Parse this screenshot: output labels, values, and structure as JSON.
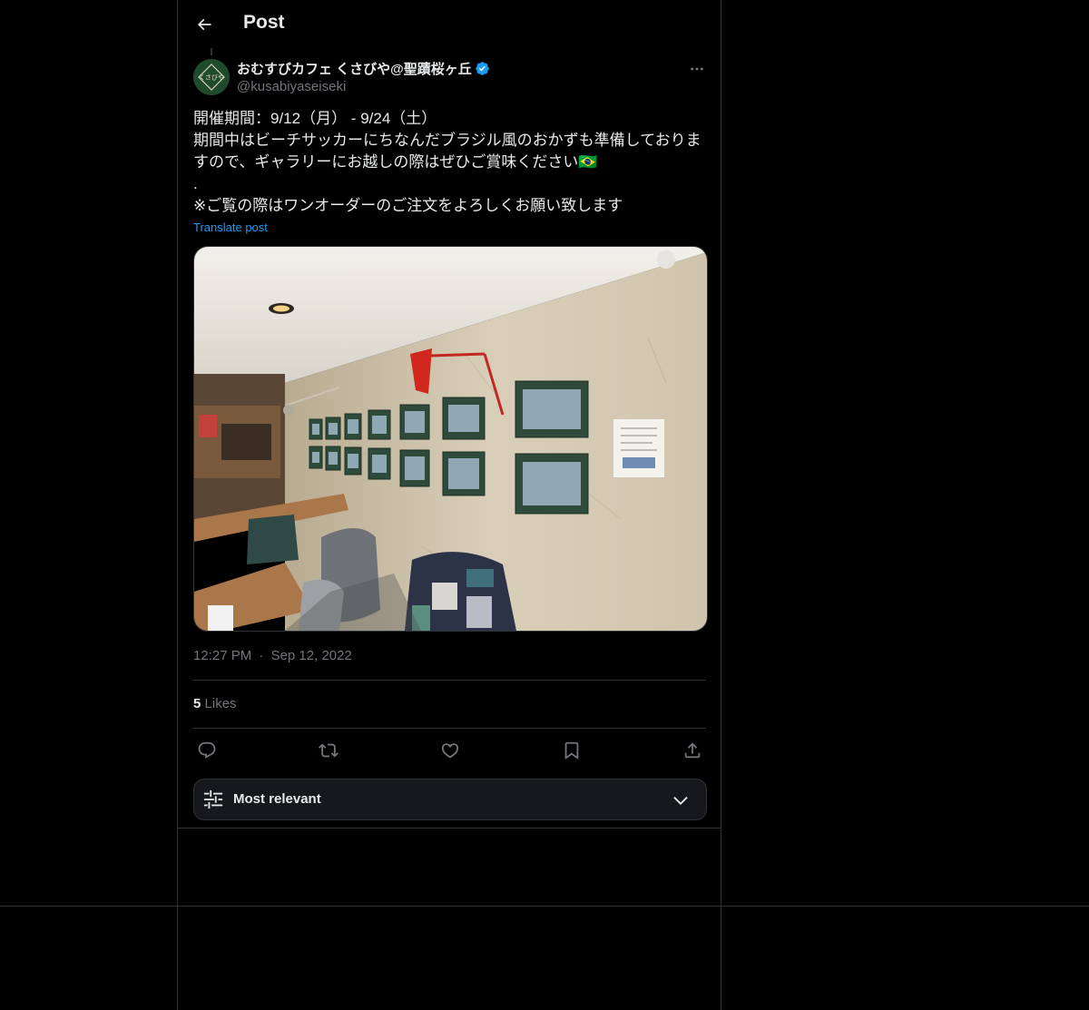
{
  "header": {
    "title": "Post"
  },
  "author": {
    "name": "おむすびカフェ くさびや@聖蹟桜ヶ丘",
    "handle": "@kusabiyaseiseki",
    "avatar_text": "くさびや"
  },
  "post": {
    "lines": [
      "開催期間：9/12（月） - 9/24（土）",
      "期間中はビーチサッカーにちなんだブラジル風のおかずも準備しておりますので、ギャラリーにお越しの際はぜひご賞味ください🇧🇷",
      ".",
      "※ご覧の際はワンオーダーのご注文をよろしくお願い致します"
    ],
    "translate_label": "Translate post",
    "time": "12:27 PM",
    "separator": "·",
    "date": "Sep 12, 2022"
  },
  "stats": {
    "likes_count": "5",
    "likes_label": "Likes"
  },
  "actions": {
    "icons": [
      "reply-icon",
      "repost-icon",
      "like-icon",
      "bookmark-icon",
      "share-icon"
    ]
  },
  "replies_sort": {
    "label": "Most relevant"
  },
  "colors": {
    "background": "#000000",
    "border": "#2f3336",
    "text_primary": "#e7e9ea",
    "text_secondary": "#71767b",
    "link": "#1d9bf0",
    "verified": "#1d9bf0"
  }
}
